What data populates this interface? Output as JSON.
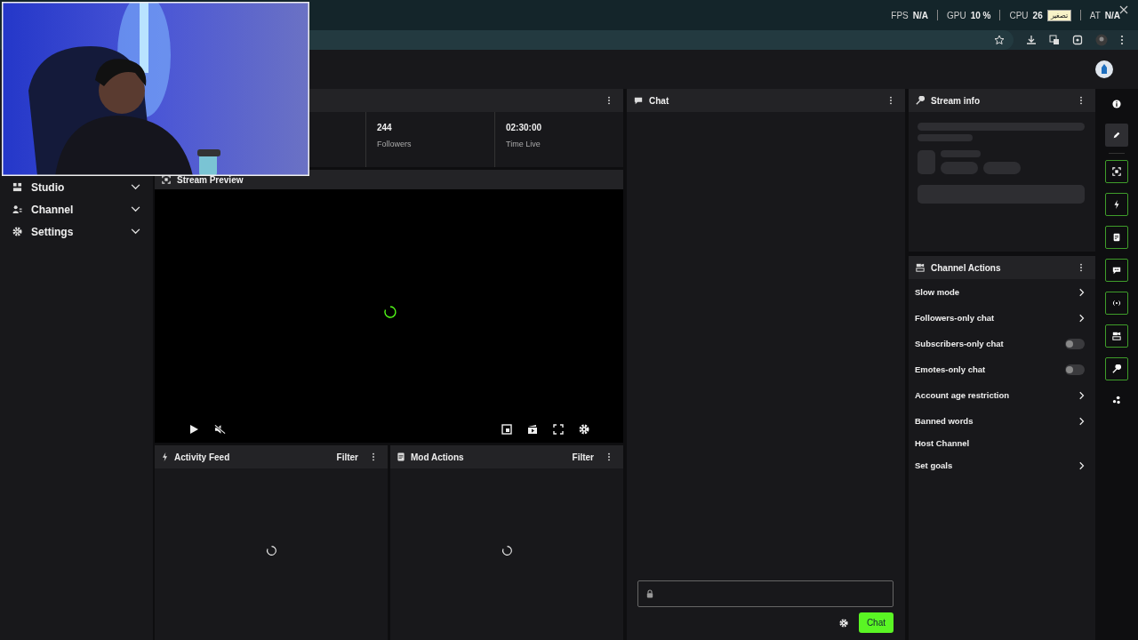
{
  "browser": {
    "stats": [
      {
        "label": "FPS",
        "value": "N/A"
      },
      {
        "label": "GPU",
        "value": "10 %"
      },
      {
        "label": "CPU",
        "value": "26"
      },
      {
        "label": "AT",
        "value": "N/A"
      }
    ],
    "tooltip": "تصغير"
  },
  "sidebar": {
    "items": [
      {
        "label": "Studio"
      },
      {
        "label": "Channel"
      },
      {
        "label": "Settings"
      }
    ]
  },
  "stats_panel": {
    "cells": [
      {
        "value": "244",
        "label": "Followers"
      },
      {
        "value": "02:30:00",
        "label": "Time Live"
      }
    ]
  },
  "preview": {
    "title": "Stream Preview"
  },
  "feeds": [
    {
      "title": "Activity Feed",
      "filter": "Filter"
    },
    {
      "title": "Mod Actions",
      "filter": "Filter"
    }
  ],
  "chat": {
    "title": "Chat",
    "send": "Chat"
  },
  "stream_info": {
    "title": "Stream info"
  },
  "channel_actions": {
    "title": "Channel Actions",
    "rows": [
      {
        "label": "Slow mode",
        "kind": "link"
      },
      {
        "label": "Followers-only chat",
        "kind": "link"
      },
      {
        "label": "Subscribers-only chat",
        "kind": "toggle",
        "on": false
      },
      {
        "label": "Emotes-only chat",
        "kind": "toggle",
        "on": false
      },
      {
        "label": "Account age restriction",
        "kind": "link"
      },
      {
        "label": "Banned words",
        "kind": "link"
      },
      {
        "label": "Host Channel",
        "kind": "plain"
      },
      {
        "label": "Set goals",
        "kind": "link"
      }
    ]
  },
  "rail": [
    {
      "kind": "plain"
    },
    {
      "kind": "active"
    },
    {
      "kind": "outlined"
    },
    {
      "kind": "outlined"
    },
    {
      "kind": "outlined"
    },
    {
      "kind": "outlined"
    },
    {
      "kind": "outlined"
    },
    {
      "kind": "outlined"
    },
    {
      "kind": "outlined"
    },
    {
      "kind": "plain"
    }
  ]
}
